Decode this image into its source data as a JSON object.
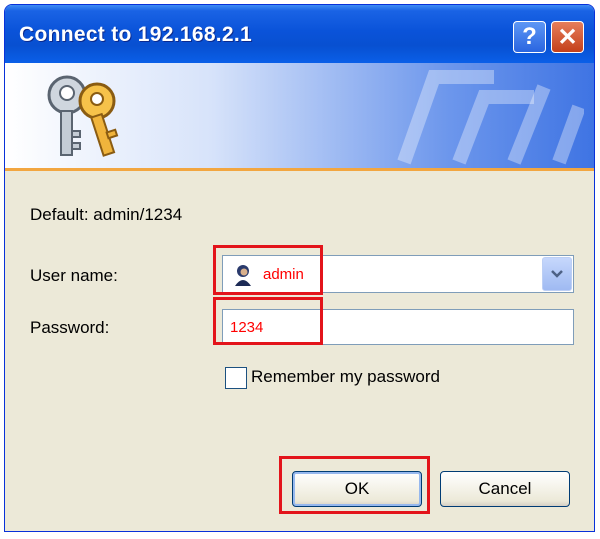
{
  "dialog": {
    "title": "Connect to 192.168.2.1",
    "help_label": "?",
    "close_label": "✕",
    "default_hint": "Default: admin/1234",
    "username_label": "User name:",
    "username_value": "admin",
    "password_label": "Password:",
    "password_value": "1234",
    "remember_label": "Remember my password",
    "remember_checked": false,
    "ok_label": "OK",
    "cancel_label": "Cancel"
  },
  "icons": {
    "banner": "keys-icon",
    "user": "user-icon",
    "dropdown": "chevron-down-icon"
  },
  "colors": {
    "titlebar": "#0a53d9",
    "highlight": "#e3141b",
    "entered_text": "#ff0000",
    "banner_rule": "#f2a640"
  }
}
